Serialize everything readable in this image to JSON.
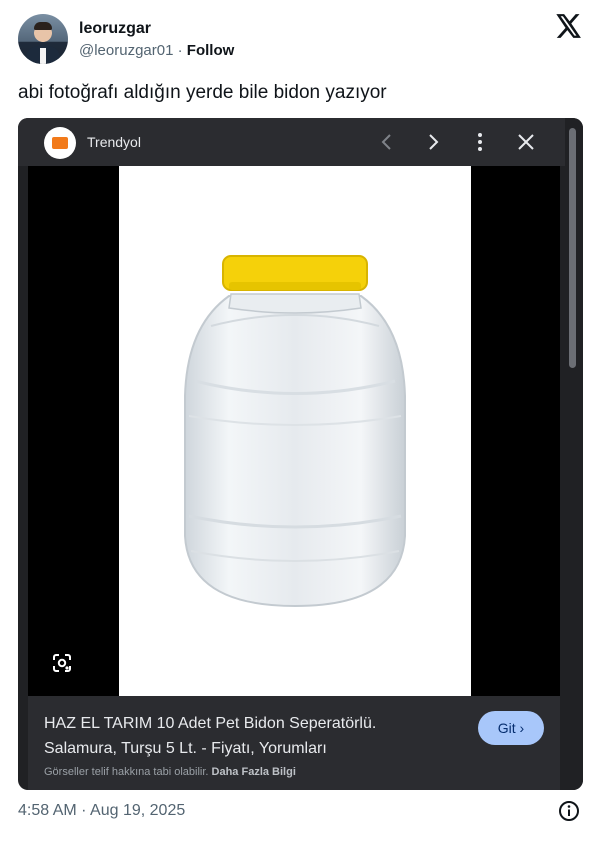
{
  "tweet": {
    "author_name": "leoruzgar",
    "handle": "@leoruzgar01",
    "separator": "·",
    "follow_label": "Follow",
    "text": "abi fotoğrafı aldığın yerde bile bidon yazıyor",
    "timestamp": "4:58 AM · Aug 19, 2025"
  },
  "screenshot": {
    "site_name": "Trendyol",
    "product_title_line1": "HAZ EL TARIM 10 Adet Pet Bidon Seperatörlü.",
    "product_title_line2": "Salamura, Turşu 5 Lt. - Fiyatı, Yorumları",
    "go_button_label": "Git",
    "copyright_text": "Görseller telif hakkına tabi olabilir.",
    "learn_more_label": "Daha Fazla Bilgi"
  },
  "icons": {
    "x_logo": "x-logo-icon",
    "site_favicon": "trendyol-icon",
    "prev": "chevron-left-icon",
    "next": "chevron-right-icon",
    "more": "more-vert-icon",
    "close": "close-icon",
    "lens": "google-lens-icon",
    "info": "info-icon"
  },
  "colors": {
    "brand_orange": "#f27a1a",
    "button_blue": "#a8c7fa",
    "lid_yellow": "#f5d10a"
  }
}
